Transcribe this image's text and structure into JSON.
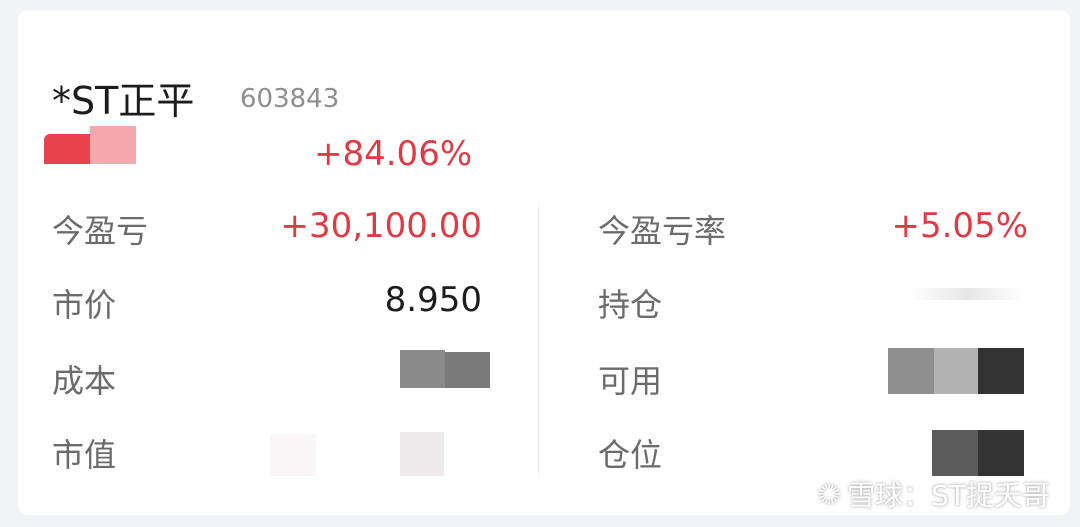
{
  "stock": {
    "name": "*ST正平",
    "code": "603843",
    "change_pct": "+84.06%"
  },
  "rows": [
    {
      "left_label": "今盈亏",
      "left_value": "+30,100.00",
      "right_label": "今盈亏率",
      "right_value": "+5.05%"
    },
    {
      "left_label": "市价",
      "left_value": "8.950",
      "right_label": "持仓",
      "right_value": ""
    },
    {
      "left_label": "成本",
      "left_value": "",
      "right_label": "可用",
      "right_value": ""
    },
    {
      "left_label": "市值",
      "left_value": "",
      "right_label": "仓位",
      "right_value": ""
    }
  ],
  "watermark": {
    "text": "雪球：ST捉夭哥",
    "icon": "xueqiu-logo-icon"
  },
  "colors": {
    "gain_red": "#e03a45",
    "text_dark": "#1c1c1c",
    "label_gray": "#6b6b6b",
    "code_gray": "#8f8f8f"
  }
}
